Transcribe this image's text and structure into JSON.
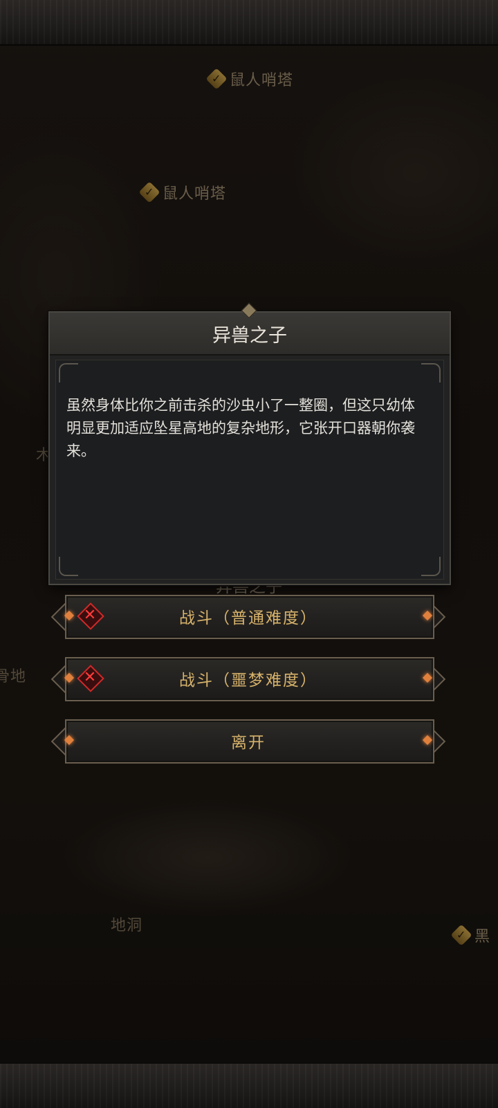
{
  "map": {
    "labels": [
      {
        "text": "鼠人哨塔",
        "checked": true
      },
      {
        "text": "鼠人哨塔",
        "checked": true
      },
      {
        "text": "木",
        "checked": false
      },
      {
        "text": "骨地",
        "checked": false
      },
      {
        "text": "地洞",
        "checked": false
      },
      {
        "text": "黑",
        "checked": true
      }
    ]
  },
  "dialog": {
    "title": "异兽之子",
    "description": "虽然身体比你之前击杀的沙虫小了一整圈，但这只幼体明显更加适应坠星高地的复杂地形，它张开口器朝你袭来。"
  },
  "behind_title": "异兽之子",
  "choices": [
    {
      "label": "战斗（普通难度）",
      "cleared": false
    },
    {
      "label": "战斗（噩梦难度）",
      "cleared": false
    },
    {
      "label": "离开"
    }
  ],
  "icons": {
    "check": "✓",
    "failed": "✕"
  },
  "colors": {
    "accent_gold": "#d7b36b",
    "failed_red": "#d12a2a",
    "gem_orange": "#e0803d"
  }
}
